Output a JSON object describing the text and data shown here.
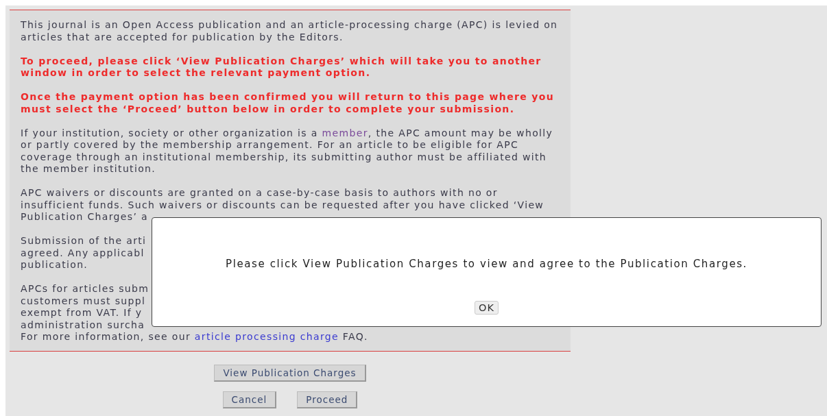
{
  "notice": {
    "paragraphs": [
      {
        "kind": "plain",
        "parts": [
          {
            "text": "This journal is an Open Access publication and an article-processing charge (APC) is levied on articles that are accepted for publication by the Editors."
          }
        ]
      },
      {
        "kind": "alert",
        "parts": [
          {
            "text": "To proceed, please click ‘View Publication Charges’ which will take you to another window in order to select the relevant payment option."
          }
        ]
      },
      {
        "kind": "alert",
        "parts": [
          {
            "text": "Once the payment option has been confirmed you will return to this page where you must select the ‘Proceed’ button below in order to complete your submission."
          }
        ]
      },
      {
        "kind": "plain",
        "parts": [
          {
            "text": "If your institution, society or other organization is a "
          },
          {
            "text": "member",
            "kind": "link"
          },
          {
            "text": ", the APC amount may be wholly or partly covered by the membership arrangement. For an article to be eligible for APC coverage through an institutional membership, its submitting author must be affiliated with the member institution."
          }
        ]
      },
      {
        "kind": "plain",
        "lines": [
          [
            {
              "text": "APC waivers or discounts are granted on a case-by-case basis to authors with no or"
            }
          ],
          [
            {
              "text": "insufficient funds. Such waivers or discounts can be requested after you have clicked ‘View"
            }
          ],
          [
            {
              "text": "Publication Charges’ a"
            }
          ]
        ]
      },
      {
        "kind": "plain",
        "lines": [
          [
            {
              "text": "Submission of the arti"
            }
          ],
          [
            {
              "text": "agreed. Any applicabl"
            }
          ],
          [
            {
              "text": "publication."
            }
          ]
        ]
      },
      {
        "kind": "plain",
        "lines": [
          [
            {
              "text": "APCs for articles subm"
            }
          ],
          [
            {
              "text": "customers must suppl"
            }
          ],
          [
            {
              "text": "exempt from VAT. If y"
            }
          ],
          [
            {
              "text": "administration surcha"
            }
          ],
          [
            {
              "text": "For more information, see our "
            },
            {
              "text": "article processing charge",
              "kind": "link2"
            },
            {
              "text": " FAQ."
            }
          ]
        ]
      }
    ]
  },
  "view_button": "View Publication Charges",
  "actions": [
    "Cancel",
    "Proceed"
  ],
  "dialog": {
    "message": "Please click View Publication Charges to view and agree to the Publication Charges.",
    "button": "OK"
  }
}
